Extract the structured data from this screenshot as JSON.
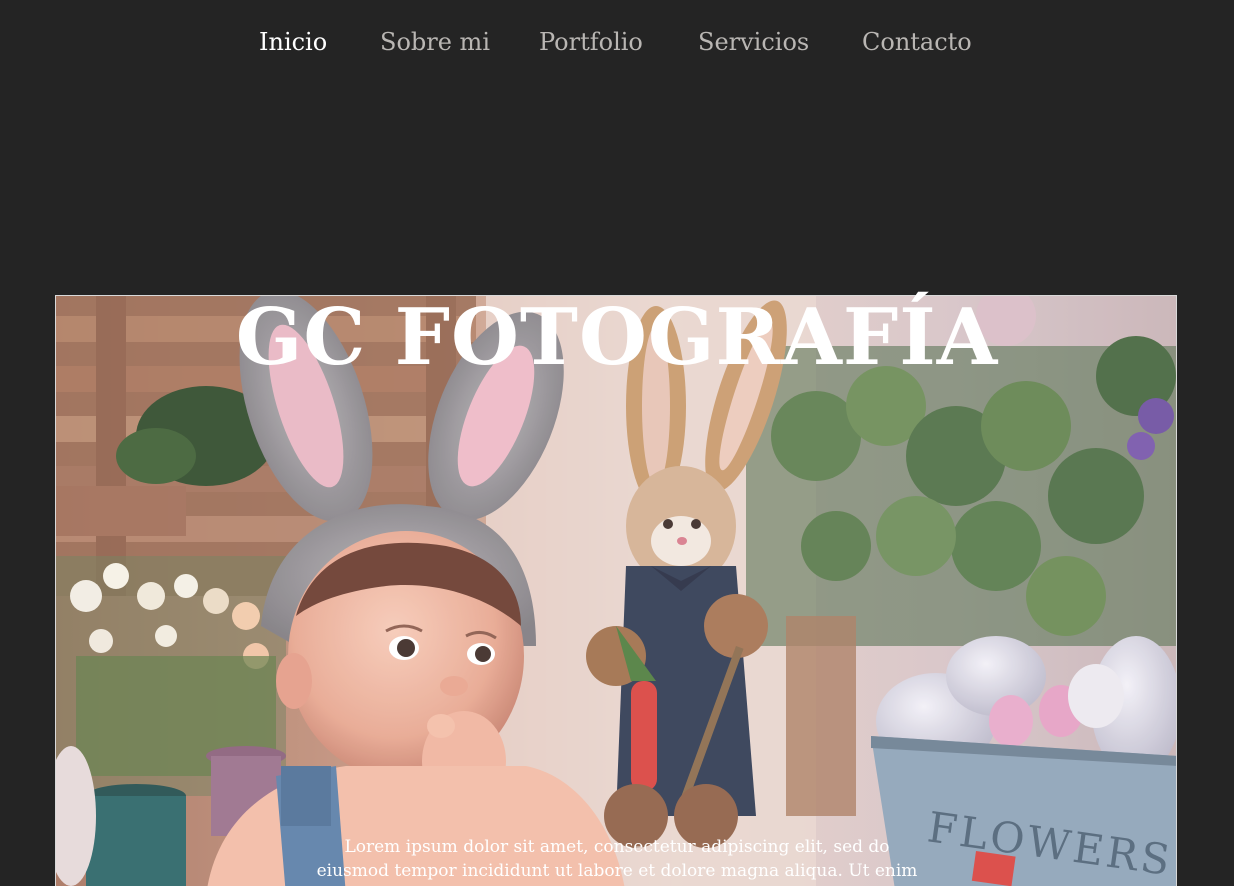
{
  "nav": {
    "items": [
      {
        "label": "Inicio",
        "active": true
      },
      {
        "label": "Sobre mi",
        "active": false
      },
      {
        "label": "Portfolio",
        "active": false
      },
      {
        "label": "Servicios",
        "active": false
      },
      {
        "label": "Contacto",
        "active": false
      }
    ]
  },
  "hero": {
    "title": "GC FOTOGRAFÍA",
    "body": "Lorem ipsum dolor sit amet, consectetur adipiscing elit, sed do eiusmod tempor incididunt ut labore et dolore magna aliqua. Ut enim ad minim veniam, quis nostrud exercitation ullamco laboris",
    "bucket_text": "FLOWERS"
  },
  "colors": {
    "background": "#242424",
    "nav_inactive": "#b9b6b3",
    "nav_active": "#ffffff",
    "title": "#ffffff",
    "frame_border": "#d9d9d9"
  }
}
